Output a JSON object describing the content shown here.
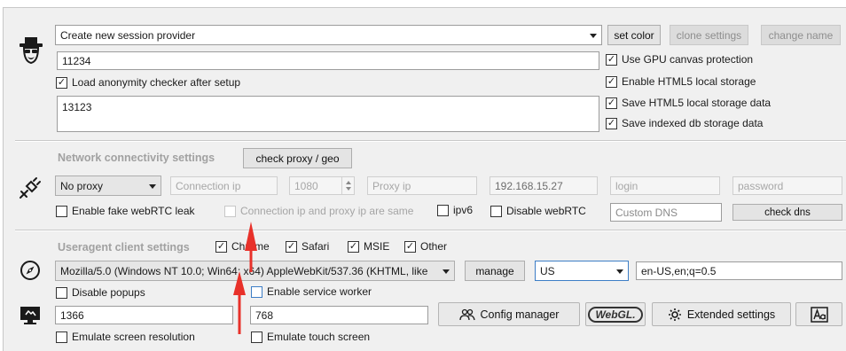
{
  "colors": {
    "annotation_arrow": "#e8312a",
    "accent_blue": "#3d7ec6"
  },
  "session": {
    "provider_select": "Create new session provider",
    "set_color": "set color",
    "clone_settings": "clone settings",
    "change_name": "change name",
    "name_value": "11234",
    "load_anonymity": "Load anonymity checker after setup",
    "notes_value": "13123",
    "gpu_canvas": "Use GPU canvas protection",
    "html5_storage": "Enable HTML5 local storage",
    "save_html5": "Save HTML5 local storage data",
    "save_indexed": "Save indexed db storage data",
    "icon": "heisenberg-avatar-icon"
  },
  "network": {
    "title": "Network connectivity settings",
    "check_proxy": "check proxy / geo",
    "proxy_type": "No proxy",
    "connection_ip_placeholder": "Connection ip",
    "port": "1080",
    "proxy_ip_placeholder": "Proxy ip",
    "ip_value": "192.168.15.27",
    "login_placeholder": "login",
    "password_placeholder": "password",
    "fake_webrtc": "Enable fake webRTC leak",
    "same_ip": "Connection ip and proxy ip are same",
    "ipv6": "ipv6",
    "disable_webrtc": "Disable webRTC",
    "custom_dns_placeholder": "Custom DNS",
    "check_dns": "check dns",
    "icon": "plug-icon"
  },
  "useragent": {
    "title": "Useragent client settings",
    "chrome": "Chrome",
    "safari": "Safari",
    "msie": "MSIE",
    "other": "Other",
    "ua_string": "Mozilla/5.0 (Windows NT 10.0; Win64; x64) AppleWebKit/537.36 (KHTML, like",
    "manage": "manage",
    "country": "US",
    "language": "en-US,en;q=0.5",
    "disable_popups": "Disable popups",
    "service_worker": "Enable service worker",
    "icon": "compass-icon"
  },
  "screen": {
    "width": "1366",
    "height": "768",
    "config_manager": "Config manager",
    "webgl": "WebGL.",
    "extended_settings": "Extended settings",
    "emulate_resolution": "Emulate screen resolution",
    "emulate_touch": "Emulate touch screen",
    "icon": "monitor-icon"
  }
}
